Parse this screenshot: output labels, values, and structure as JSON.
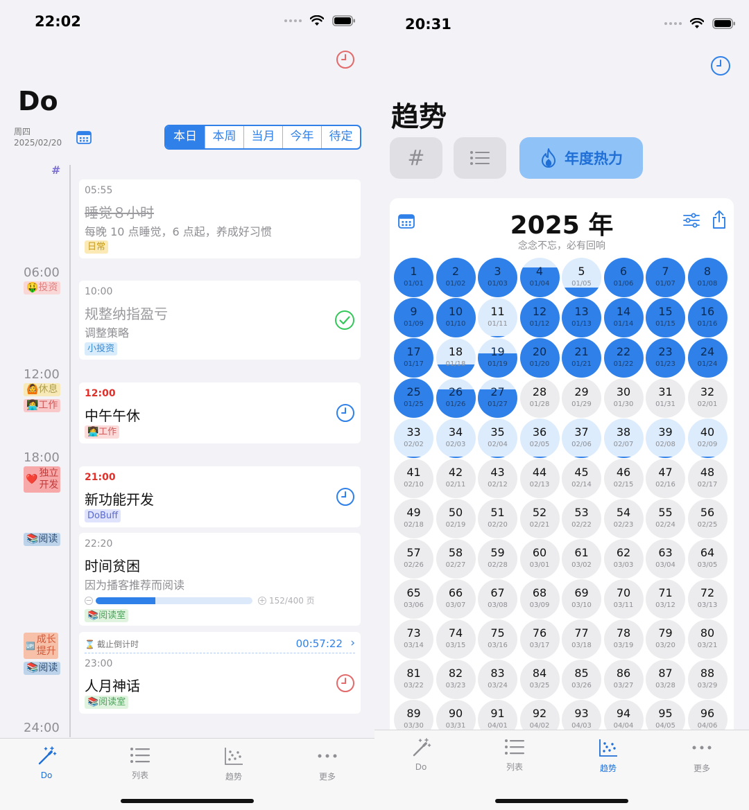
{
  "left": {
    "status_time": "22:02",
    "title": "Do",
    "weekday": "周四",
    "date": "2025/02/20",
    "hash_label": "#",
    "segments": [
      {
        "label": "本日",
        "active": true
      },
      {
        "label": "本周",
        "active": false
      },
      {
        "label": "当月",
        "active": false
      },
      {
        "label": "今年",
        "active": false
      },
      {
        "label": "待定",
        "active": false
      }
    ],
    "hours": [
      "06:00",
      "12:00",
      "18:00",
      "24:00"
    ],
    "side_tags": {
      "invest": "🤑投资",
      "rest": "🙆休息",
      "work": "👩‍💻工作",
      "dev_line1": "独立",
      "dev_line2": "开发",
      "dev_emoji": "❤️",
      "read1": "📚阅读",
      "grow_line1": "成长",
      "grow_line2": "提升",
      "grow_emoji": "🆙",
      "read2": "📚阅读"
    },
    "cards": {
      "sleep": {
        "time": "05:55",
        "title": "睡觉８小时",
        "desc": "每晚 10 点睡觉，6 点起，养成好习惯",
        "tag": "日常"
      },
      "finance": {
        "time": "10:00",
        "title": "规整纳指盈亏",
        "desc": "调整策略",
        "tag": "小投资"
      },
      "nap": {
        "time": "12:00",
        "title": "中午午休",
        "tag": "👩‍💻工作"
      },
      "feature": {
        "time": "21:00",
        "title": "新功能开发",
        "tag": "DoBuff"
      },
      "reading": {
        "time": "22:20",
        "title": "时间贫困",
        "desc": "因为播客推荐而阅读",
        "progress": 0.38,
        "progress_text": "152/400 页",
        "tag": "📚阅读室"
      },
      "mythical": {
        "countdown_label": "截止倒计时",
        "countdown": "00:57:22",
        "time": "23:00",
        "title": "人月神话",
        "tag": "📚阅读室"
      }
    },
    "tabs": [
      {
        "label": "Do",
        "icon": "magic-wand-icon",
        "active": true
      },
      {
        "label": "列表",
        "icon": "list-icon",
        "active": false
      },
      {
        "label": "趋势",
        "icon": "scatter-chart-icon",
        "active": false
      },
      {
        "label": "更多",
        "icon": "more-icon",
        "active": false
      }
    ],
    "colors": {
      "accent": "#2f80e8",
      "red": "#e0302a",
      "green": "#34c759"
    }
  },
  "right": {
    "status_time": "20:31",
    "title": "趋势",
    "chips": [
      {
        "label": "#",
        "icon": "hash-icon"
      },
      {
        "label": "",
        "icon": "list-icon"
      },
      {
        "label": "年度热力",
        "icon": "flame-icon"
      }
    ],
    "calendar": {
      "year_title": "2025 年",
      "subtitle": "念念不忘，必有回响",
      "days": [
        {
          "num": "1",
          "date": "01/01",
          "level": 1
        },
        {
          "num": "2",
          "date": "01/02",
          "level": 1
        },
        {
          "num": "3",
          "date": "01/03",
          "level": 1
        },
        {
          "num": "4",
          "date": "01/04",
          "level": 0.75
        },
        {
          "num": "5",
          "date": "01/05",
          "level": 0.25
        },
        {
          "num": "6",
          "date": "01/06",
          "level": 1
        },
        {
          "num": "7",
          "date": "01/07",
          "level": 1
        },
        {
          "num": "8",
          "date": "01/08",
          "level": 1
        },
        {
          "num": "9",
          "date": "01/09",
          "level": 1
        },
        {
          "num": "10",
          "date": "01/10",
          "level": 1
        },
        {
          "num": "11",
          "date": "01/11",
          "level": 0.04
        },
        {
          "num": "12",
          "date": "01/12",
          "level": 1
        },
        {
          "num": "13",
          "date": "01/13",
          "level": 1
        },
        {
          "num": "14",
          "date": "01/14",
          "level": 1
        },
        {
          "num": "15",
          "date": "01/15",
          "level": 1
        },
        {
          "num": "16",
          "date": "01/16",
          "level": 1
        },
        {
          "num": "17",
          "date": "01/17",
          "level": 1
        },
        {
          "num": "18",
          "date": "01/18",
          "level": 0.33
        },
        {
          "num": "19",
          "date": "01/19",
          "level": 0.62
        },
        {
          "num": "20",
          "date": "01/20",
          "level": 1
        },
        {
          "num": "21",
          "date": "01/21",
          "level": 1
        },
        {
          "num": "22",
          "date": "01/22",
          "level": 1
        },
        {
          "num": "23",
          "date": "01/23",
          "level": 1
        },
        {
          "num": "24",
          "date": "01/24",
          "level": 1
        },
        {
          "num": "25",
          "date": "01/25",
          "level": 1
        },
        {
          "num": "26",
          "date": "01/26",
          "level": 0.72
        },
        {
          "num": "27",
          "date": "01/27",
          "level": 0.72
        },
        {
          "num": "28",
          "date": "01/28",
          "level": 0
        },
        {
          "num": "29",
          "date": "01/29",
          "level": 0
        },
        {
          "num": "30",
          "date": "01/30",
          "level": 0
        },
        {
          "num": "31",
          "date": "01/31",
          "level": 0
        },
        {
          "num": "32",
          "date": "02/01",
          "level": 0
        },
        {
          "num": "33",
          "date": "02/02",
          "level": 0.04
        },
        {
          "num": "34",
          "date": "02/03",
          "level": 0.04
        },
        {
          "num": "35",
          "date": "02/04",
          "level": 0.04
        },
        {
          "num": "36",
          "date": "02/05",
          "level": 0.04
        },
        {
          "num": "37",
          "date": "02/06",
          "level": 0.04
        },
        {
          "num": "38",
          "date": "02/07",
          "level": 0.04
        },
        {
          "num": "39",
          "date": "02/08",
          "level": 0.04
        },
        {
          "num": "40",
          "date": "02/09",
          "level": 0.04
        },
        {
          "num": "41",
          "date": "02/10",
          "level": 0
        },
        {
          "num": "42",
          "date": "02/11",
          "level": 0
        },
        {
          "num": "43",
          "date": "02/12",
          "level": 0
        },
        {
          "num": "44",
          "date": "02/13",
          "level": 0
        },
        {
          "num": "45",
          "date": "02/14",
          "level": 0
        },
        {
          "num": "46",
          "date": "02/15",
          "level": 0
        },
        {
          "num": "47",
          "date": "02/16",
          "level": 0
        },
        {
          "num": "48",
          "date": "02/17",
          "level": 0
        },
        {
          "num": "49",
          "date": "02/18",
          "level": 0
        },
        {
          "num": "50",
          "date": "02/19",
          "level": 0
        },
        {
          "num": "51",
          "date": "02/20",
          "level": 0
        },
        {
          "num": "52",
          "date": "02/21",
          "level": 0
        },
        {
          "num": "53",
          "date": "02/22",
          "level": 0
        },
        {
          "num": "54",
          "date": "02/23",
          "level": 0
        },
        {
          "num": "55",
          "date": "02/24",
          "level": 0
        },
        {
          "num": "56",
          "date": "02/25",
          "level": 0
        },
        {
          "num": "57",
          "date": "02/26",
          "level": 0
        },
        {
          "num": "58",
          "date": "02/27",
          "level": 0
        },
        {
          "num": "59",
          "date": "02/28",
          "level": 0
        },
        {
          "num": "60",
          "date": "03/01",
          "level": 0
        },
        {
          "num": "61",
          "date": "03/02",
          "level": 0
        },
        {
          "num": "62",
          "date": "03/03",
          "level": 0
        },
        {
          "num": "63",
          "date": "03/04",
          "level": 0
        },
        {
          "num": "64",
          "date": "03/05",
          "level": 0
        },
        {
          "num": "65",
          "date": "03/06",
          "level": 0
        },
        {
          "num": "66",
          "date": "03/07",
          "level": 0
        },
        {
          "num": "67",
          "date": "03/08",
          "level": 0
        },
        {
          "num": "68",
          "date": "03/09",
          "level": 0
        },
        {
          "num": "69",
          "date": "03/10",
          "level": 0
        },
        {
          "num": "70",
          "date": "03/11",
          "level": 0
        },
        {
          "num": "71",
          "date": "03/12",
          "level": 0
        },
        {
          "num": "72",
          "date": "03/13",
          "level": 0
        },
        {
          "num": "73",
          "date": "03/14",
          "level": 0
        },
        {
          "num": "74",
          "date": "03/15",
          "level": 0
        },
        {
          "num": "75",
          "date": "03/16",
          "level": 0
        },
        {
          "num": "76",
          "date": "03/17",
          "level": 0
        },
        {
          "num": "77",
          "date": "03/18",
          "level": 0
        },
        {
          "num": "78",
          "date": "03/19",
          "level": 0
        },
        {
          "num": "79",
          "date": "03/20",
          "level": 0
        },
        {
          "num": "80",
          "date": "03/21",
          "level": 0
        },
        {
          "num": "81",
          "date": "03/22",
          "level": 0
        },
        {
          "num": "82",
          "date": "03/23",
          "level": 0
        },
        {
          "num": "83",
          "date": "03/24",
          "level": 0
        },
        {
          "num": "84",
          "date": "03/25",
          "level": 0
        },
        {
          "num": "85",
          "date": "03/26",
          "level": 0
        },
        {
          "num": "86",
          "date": "03/27",
          "level": 0
        },
        {
          "num": "87",
          "date": "03/28",
          "level": 0
        },
        {
          "num": "88",
          "date": "03/29",
          "level": 0
        },
        {
          "num": "89",
          "date": "03/30",
          "level": 0
        },
        {
          "num": "90",
          "date": "03/31",
          "level": 0
        },
        {
          "num": "91",
          "date": "04/01",
          "level": 0
        },
        {
          "num": "92",
          "date": "04/02",
          "level": 0
        },
        {
          "num": "93",
          "date": "04/03",
          "level": 0
        },
        {
          "num": "94",
          "date": "04/04",
          "level": 0
        },
        {
          "num": "95",
          "date": "04/05",
          "level": 0
        },
        {
          "num": "96",
          "date": "04/06",
          "level": 0
        }
      ]
    },
    "tabs": [
      {
        "label": "Do",
        "icon": "magic-wand-icon",
        "active": false
      },
      {
        "label": "列表",
        "icon": "list-icon",
        "active": false
      },
      {
        "label": "趋势",
        "icon": "scatter-chart-icon",
        "active": true
      },
      {
        "label": "更多",
        "icon": "more-icon",
        "active": false
      }
    ]
  }
}
